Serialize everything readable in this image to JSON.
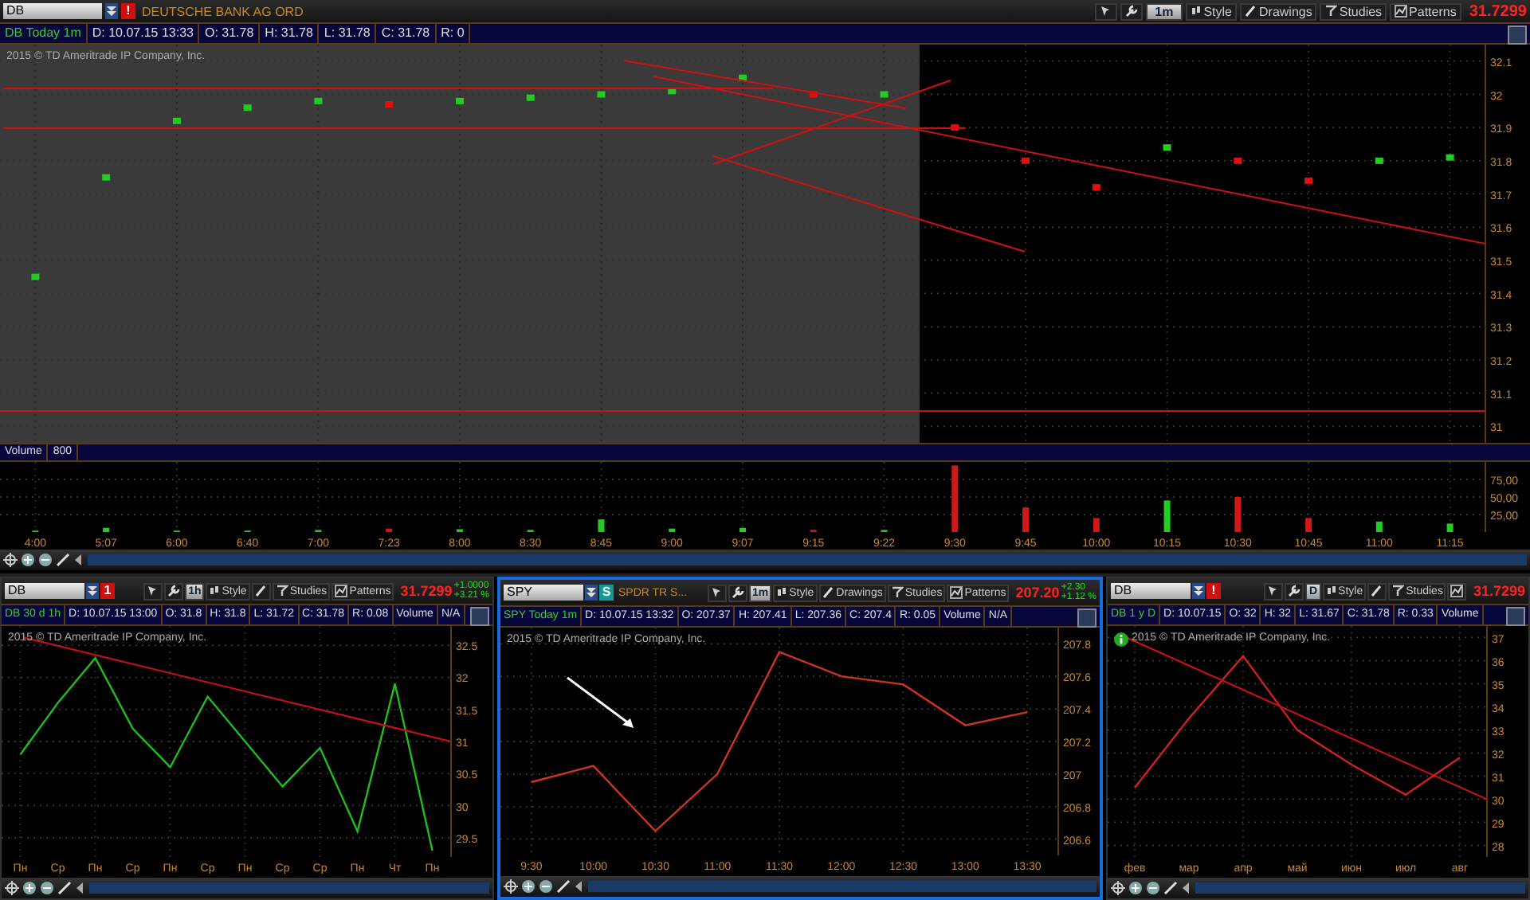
{
  "main_window": {
    "symbol": "DB",
    "badge": {
      "text": "!",
      "color": "#d01010"
    },
    "company": "DEUTSCHE BANK AG ORD",
    "toolbar": [
      {
        "kind": "cursor"
      },
      {
        "kind": "wrench"
      },
      {
        "kind": "aggregation",
        "label": "1m"
      },
      {
        "kind": "style",
        "label": "Style"
      },
      {
        "kind": "drawings",
        "label": "Drawings"
      },
      {
        "kind": "studies",
        "label": "Studies"
      },
      {
        "kind": "patterns",
        "label": "Patterns"
      }
    ],
    "price": "31.7299",
    "info": {
      "title": "DB Today 1m",
      "fields": [
        "D: 10.07.15 13:33",
        "O: 31.78",
        "H: 31.78",
        "L: 31.78",
        "C: 31.78",
        "R: 0"
      ]
    },
    "copyright": "2015 © TD Ameritrade IP Company, Inc.",
    "chart_data": {
      "type": "scatter",
      "grid": true,
      "ylim": [
        30.95,
        32.15
      ],
      "yticks": [
        32.1,
        32,
        31.9,
        31.8,
        31.7,
        31.6,
        31.5,
        31.4,
        31.3,
        31.2,
        31.1,
        31
      ],
      "series": [
        {
          "color": "#22cc22",
          "values": [
            31.45,
            31.75,
            31.92,
            31.96,
            31.98,
            null,
            31.98,
            31.99,
            32.0,
            32.01,
            32.05,
            null,
            32.0,
            null,
            null,
            null,
            31.84,
            null,
            null,
            31.8,
            31.81
          ]
        },
        {
          "color": "#e01010",
          "values": [
            null,
            null,
            null,
            null,
            null,
            31.97,
            null,
            null,
            null,
            null,
            null,
            32.0,
            null,
            31.9,
            31.8,
            31.72,
            null,
            31.8,
            31.74,
            null,
            null
          ]
        }
      ]
    },
    "volume": {
      "label": "Volume",
      "value": "800",
      "chart_data": {
        "type": "bar",
        "grid": true,
        "categories": [
          "4:00",
          "5:07",
          "6:00",
          "6:40",
          "7:00",
          "7:23",
          "8:00",
          "8:30",
          "8:45",
          "9:00",
          "9:07",
          "9:15",
          "9:22",
          "9:30",
          "9:45",
          "10:00",
          "10:15",
          "10:30",
          "10:45",
          "11:00",
          "11:15"
        ],
        "ylim": [
          0,
          100
        ],
        "yticks": [
          {
            "value": 75,
            "label": "75,00"
          },
          {
            "value": 50,
            "label": "50,00"
          },
          {
            "value": 25,
            "label": "25,00"
          }
        ],
        "series": [
          {
            "color": "#22cc22",
            "values": [
              2,
              6,
              2,
              2,
              3,
              null,
              4,
              3,
              18,
              5,
              6,
              null,
              3,
              null,
              null,
              null,
              45,
              null,
              null,
              15,
              12
            ]
          },
          {
            "color": "#d01818",
            "values": [
              null,
              null,
              null,
              null,
              null,
              5,
              null,
              null,
              null,
              null,
              null,
              3,
              null,
              95,
              35,
              20,
              null,
              50,
              20,
              null,
              null
            ]
          }
        ]
      }
    }
  },
  "panels": [
    {
      "symbol": "DB",
      "badge": {
        "text": "1",
        "color": "#d01010"
      },
      "selected": false,
      "info_marker": false,
      "toolbar": [
        {
          "kind": "cursor"
        },
        {
          "kind": "wrench"
        },
        {
          "kind": "aggregation",
          "label": "1h"
        },
        {
          "kind": "style",
          "label": "Style"
        },
        {
          "kind": "drawings"
        },
        {
          "kind": "studies",
          "label": "Studies"
        },
        {
          "kind": "patterns",
          "label": "Patterns"
        }
      ],
      "price": "31.7299",
      "change": [
        "+1.0000",
        "+3.21 %"
      ],
      "info": {
        "title": "DB 30 d 1h",
        "fields": [
          "D: 10.07.15 13:00",
          "O: 31.8",
          "H: 31.8",
          "L: 31.72",
          "C: 31.78",
          "R: 0.08",
          "Volume",
          "N/A"
        ]
      },
      "copyright": "2015 © TD Ameritrade IP Company, Inc.",
      "chart_data": {
        "type": "line",
        "grid": true,
        "categories": [
          "Пн",
          "Ср",
          "Пн",
          "Ср",
          "Пн",
          "Ср",
          "Пн",
          "Ср",
          "Ср",
          "Пн",
          "Чт",
          "Пн"
        ],
        "ylim": [
          29.2,
          32.8
        ],
        "yticks": [
          32.5,
          32,
          31.5,
          31,
          30.5,
          30,
          29.5
        ],
        "series": [
          {
            "color": "#22bb22",
            "values": [
              30.8,
              31.6,
              32.3,
              31.2,
              30.6,
              31.7,
              31.0,
              30.3,
              30.9,
              29.6,
              31.9,
              29.3
            ]
          }
        ]
      }
    },
    {
      "symbol": "SPY",
      "badge": {
        "text": "S",
        "color": "#119999"
      },
      "company": "SPDR TR S...",
      "selected": true,
      "info_marker": false,
      "toolbar": [
        {
          "kind": "cursor"
        },
        {
          "kind": "wrench"
        },
        {
          "kind": "aggregation",
          "label": "1m"
        },
        {
          "kind": "style",
          "label": "Style"
        },
        {
          "kind": "drawings",
          "label": "Drawings"
        },
        {
          "kind": "studies",
          "label": "Studies"
        },
        {
          "kind": "patterns",
          "label": "Patterns"
        }
      ],
      "price": "207.20",
      "change": [
        "+2.30",
        "+1.12 %"
      ],
      "info": {
        "title": "SPY Today 1m",
        "fields": [
          "D: 10.07.15 13:32",
          "O: 207.37",
          "H: 207.41",
          "L: 207.36",
          "C: 207.4",
          "R: 0.05",
          "Volume",
          "N/A"
        ]
      },
      "copyright": "2015 © TD Ameritrade IP Company, Inc.",
      "chart_data": {
        "type": "line",
        "grid": true,
        "categories": [
          "9:30",
          "10:00",
          "10:30",
          "11:00",
          "11:30",
          "12:00",
          "12:30",
          "13:00",
          "13:30"
        ],
        "ylim": [
          206.5,
          207.9
        ],
        "yticks": [
          207.8,
          207.6,
          207.4,
          207.2,
          207,
          206.8,
          206.6
        ],
        "series": [
          {
            "color": "#cc3322",
            "values": [
              206.95,
              207.05,
              206.65,
              207.0,
              207.75,
              207.6,
              207.55,
              207.3,
              207.38
            ]
          }
        ]
      }
    },
    {
      "symbol": "DB",
      "badge": {
        "text": "!",
        "color": "#d01010"
      },
      "selected": false,
      "info_marker": true,
      "toolbar": [
        {
          "kind": "cursor"
        },
        {
          "kind": "wrench"
        },
        {
          "kind": "aggregation",
          "label": "D"
        },
        {
          "kind": "style",
          "label": "Style"
        },
        {
          "kind": "drawings"
        },
        {
          "kind": "studies",
          "label": "Studies"
        },
        {
          "kind": "patterns"
        }
      ],
      "price": "31.7299",
      "info": {
        "title": "DB 1 y D",
        "fields": [
          "D: 10.07.15",
          "O: 32",
          "H: 32",
          "L: 31.67",
          "C: 31.78",
          "R: 0.33",
          "Volume"
        ]
      },
      "copyright": "2015 © TD Ameritrade IP Company, Inc.",
      "chart_data": {
        "type": "line",
        "grid": true,
        "categories": [
          "фев",
          "мар",
          "апр",
          "май",
          "июн",
          "июл",
          "авг"
        ],
        "ylim": [
          27.5,
          37.5
        ],
        "yticks": [
          37,
          36,
          35,
          34,
          33,
          32,
          31,
          30,
          29,
          28
        ],
        "series": [
          {
            "color": "#cc2222",
            "values": [
              30.5,
              33.5,
              36.2,
              33.0,
              31.5,
              30.2,
              31.8
            ]
          }
        ]
      }
    }
  ]
}
